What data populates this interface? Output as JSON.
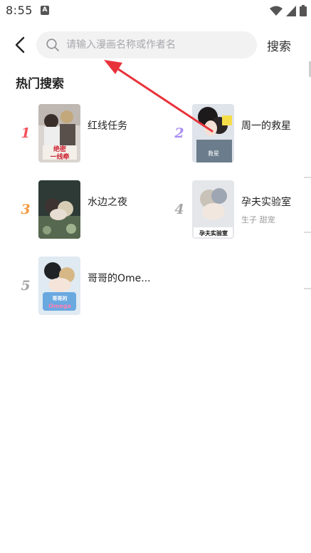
{
  "status_bar": {
    "time": "8:55",
    "notification_icon": "a-badge-icon",
    "icons": [
      "wifi-icon",
      "signal-icon",
      "battery-icon"
    ]
  },
  "header": {
    "back_icon": "chevron-left-icon",
    "search_placeholder": "请输入漫画名称或作者名",
    "search_value": "",
    "search_button": "搜索"
  },
  "hot_search": {
    "title": "热门搜索",
    "items": [
      {
        "rank": "1",
        "title": "红线任务",
        "tags": "",
        "rank_color": "#f2515a"
      },
      {
        "rank": "2",
        "title": "周一的救星",
        "tags": "",
        "rank_color": "#a98cf2"
      },
      {
        "rank": "3",
        "title": "水边之夜",
        "tags": "",
        "rank_color": "#f59a3e"
      },
      {
        "rank": "4",
        "title": "孕夫实验室",
        "tags": "生子 甜宠",
        "rank_color": "#a6a6a6"
      },
      {
        "rank": "5",
        "title": "哥哥的Ome...",
        "tags": "",
        "rank_color": "#a6a6a6"
      }
    ]
  },
  "colors": {
    "accent": "#e8333a",
    "search_bg": "#f2f2f3"
  }
}
